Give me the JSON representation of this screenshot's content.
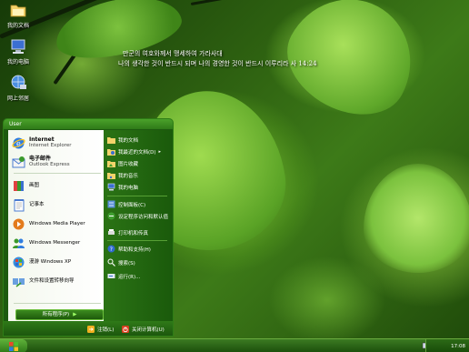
{
  "desktop": {
    "icons": [
      {
        "label": "我的文档",
        "icon": "folder-icon"
      },
      {
        "label": "我的电脑",
        "icon": "computer-icon"
      },
      {
        "label": "网上邻居",
        "icon": "network-icon"
      }
    ],
    "poem": {
      "line1": "만군의 여호와께서 맹세하여 가라사대",
      "line2": "나의 생각한 것이 반드시 되며 나의 경영한 것이 반드시 이루리라  사 14:24"
    }
  },
  "start_menu": {
    "user_name": "User",
    "pinned": [
      {
        "title": "Internet",
        "subtitle": "Internet Explorer",
        "icon": "internet-explorer-icon"
      },
      {
        "title": "电子邮件",
        "subtitle": "Outlook Express",
        "icon": "outlook-express-icon"
      }
    ],
    "programs": [
      {
        "label": "画图",
        "icon": "paint-icon"
      },
      {
        "label": "记事本",
        "icon": "notepad-icon"
      },
      {
        "label": "Windows Media Player",
        "icon": "media-player-icon"
      },
      {
        "label": "Windows Messenger",
        "icon": "messenger-icon"
      },
      {
        "label": "漫游 Windows XP",
        "icon": "tour-xp-icon"
      },
      {
        "label": "文件和设置转移向导",
        "icon": "transfer-wizard-icon"
      }
    ],
    "all_programs_label": "所有程序(P)",
    "right_items": [
      {
        "label": "我的文档",
        "icon": "my-documents-icon"
      },
      {
        "label": "我最近的文档(D)",
        "icon": "recent-documents-icon",
        "arrow": "▸"
      },
      {
        "label": "图片收藏",
        "icon": "my-pictures-icon"
      },
      {
        "label": "我的音乐",
        "icon": "my-music-icon"
      },
      {
        "label": "我的电脑",
        "icon": "my-computer-icon"
      }
    ],
    "right_items_2": [
      {
        "label": "控制面板(C)",
        "icon": "control-panel-icon"
      },
      {
        "label": "设定程序访问和默认值",
        "icon": "program-access-icon"
      },
      {
        "label": "打印机和传真",
        "icon": "printers-icon"
      }
    ],
    "right_items_3": [
      {
        "label": "帮助和支持(H)",
        "icon": "help-icon"
      },
      {
        "label": "搜索(S)",
        "icon": "search-icon"
      },
      {
        "label": "运行(R)...",
        "icon": "run-icon"
      }
    ],
    "logoff_label": "注销(L)",
    "shutdown_label": "关闭计算机(U)"
  },
  "taskbar": {
    "clock": "17:08"
  },
  "colors": {
    "menu_green": "#1d5a0f",
    "accent_green": "#4aa12a"
  }
}
